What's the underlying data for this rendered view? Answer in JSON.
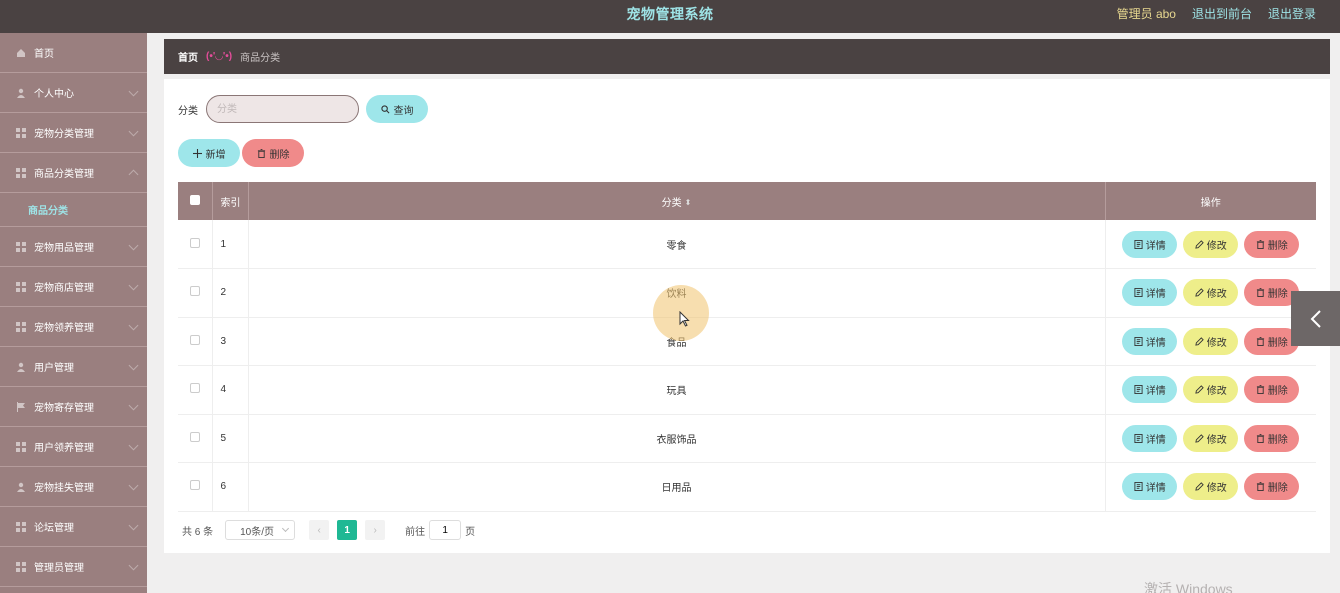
{
  "header": {
    "title": "宠物管理系统",
    "user": "管理员 abo",
    "to_front": "退出到前台",
    "logout": "退出登录"
  },
  "sidebar": {
    "items": [
      {
        "label": "首页",
        "icon": "home-icon",
        "expandable": false
      },
      {
        "label": "个人中心",
        "icon": "user-icon",
        "expandable": true
      },
      {
        "label": "宠物分类管理",
        "icon": "grid-icon",
        "expandable": true
      },
      {
        "label": "商品分类管理",
        "icon": "grid-icon",
        "expandable": true,
        "sub": [
          "商品分类"
        ]
      },
      {
        "label": "宠物用品管理",
        "icon": "grid-icon",
        "expandable": true
      },
      {
        "label": "宠物商店管理",
        "icon": "grid-icon",
        "expandable": true
      },
      {
        "label": "宠物领养管理",
        "icon": "grid-icon",
        "expandable": true
      },
      {
        "label": "用户管理",
        "icon": "user-icon",
        "expandable": true
      },
      {
        "label": "宠物寄存管理",
        "icon": "flag-icon",
        "expandable": true
      },
      {
        "label": "用户领养管理",
        "icon": "grid-icon",
        "expandable": true
      },
      {
        "label": "宠物挂失管理",
        "icon": "user-icon",
        "expandable": true
      },
      {
        "label": "论坛管理",
        "icon": "grid-icon",
        "expandable": true
      },
      {
        "label": "管理员管理",
        "icon": "grid-icon",
        "expandable": true
      }
    ]
  },
  "breadcrumb": {
    "home": "首页",
    "separator": "(•'◡'•)",
    "current": "商品分类"
  },
  "search": {
    "label": "分类",
    "placeholder": "分类",
    "query_label": "查询"
  },
  "actions": {
    "add_label": "新增",
    "delete_label": "删除"
  },
  "table": {
    "columns": {
      "index": "索引",
      "category": "分类",
      "ops": "操作"
    },
    "rows": [
      {
        "index": "1",
        "category": "零食"
      },
      {
        "index": "2",
        "category": "饮料"
      },
      {
        "index": "3",
        "category": "食品"
      },
      {
        "index": "4",
        "category": "玩具"
      },
      {
        "index": "5",
        "category": "衣服饰品"
      },
      {
        "index": "6",
        "category": "日用品"
      }
    ],
    "row_ops": {
      "detail": "详情",
      "edit": "修改",
      "delete": "删除"
    }
  },
  "pagination": {
    "total": "共 6 条",
    "page_size": "10条/页",
    "current_page": "1",
    "goto_prefix": "前往",
    "goto_value": "1",
    "goto_suffix": "页"
  },
  "watermark": "激活 Windows",
  "colors": {
    "header_bg": "#4a4242",
    "sidebar_bg": "#9a7f7f",
    "accent_cyan": "#9ee6ea",
    "accent_yellow": "#eeee8a",
    "accent_red": "#f08a8a",
    "pager_active": "#1fb894"
  }
}
